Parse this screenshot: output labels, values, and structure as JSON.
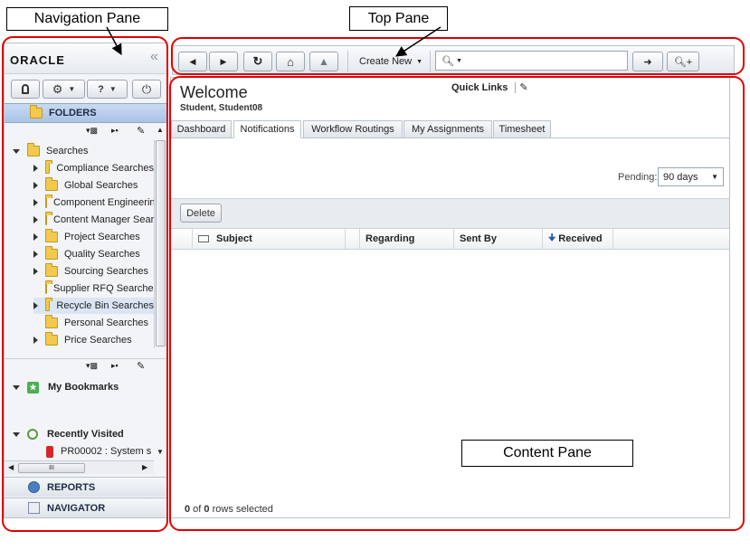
{
  "callouts": {
    "navigation_pane": "Navigation Pane",
    "top_pane": "Top Pane",
    "content_pane": "Content Pane"
  },
  "nav": {
    "logo": "ORACLE",
    "collapse_glyph": "«",
    "help_label": "?",
    "folders_label": "FOLDERS",
    "searches_label": "Searches",
    "search_items": [
      "Compliance Searches",
      "Global Searches",
      "Component Engineering",
      "Content Manager Searches",
      "Project Searches",
      "Quality Searches",
      "Sourcing Searches",
      "Supplier RFQ Searches",
      "Recycle Bin Searches",
      "Personal Searches",
      "Price Searches"
    ],
    "my_bookmarks_label": "My Bookmarks",
    "recently_visited_label": "Recently Visited",
    "recent_item": "PR00002 : System s",
    "reports_label": "REPORTS",
    "navigator_label": "NAVIGATOR",
    "hscroll_grip": "III"
  },
  "toolbar": {
    "create_new_label": "Create New",
    "search_placeholder": ""
  },
  "content": {
    "welcome": "Welcome",
    "user": "Student, Student08",
    "quick_links": "Quick Links",
    "tabs": [
      "Dashboard",
      "Notifications",
      "Workflow Routings",
      "My Assignments",
      "Timesheet"
    ],
    "active_tab": "Notifications",
    "pending_label": "Pending:",
    "pending_value": "90 days",
    "delete_label": "Delete",
    "columns": [
      "Subject",
      "Regarding",
      "Sent By",
      "Received"
    ],
    "sorted_column": "Received",
    "rows_selected_count": "0",
    "rows_selected_of": " of ",
    "rows_total": "0",
    "rows_selected_suffix": " rows selected"
  },
  "colors": {
    "callout_outline": "#e00000",
    "folders_header": "#b7cdea",
    "selected_row": "#dbe6f5"
  }
}
